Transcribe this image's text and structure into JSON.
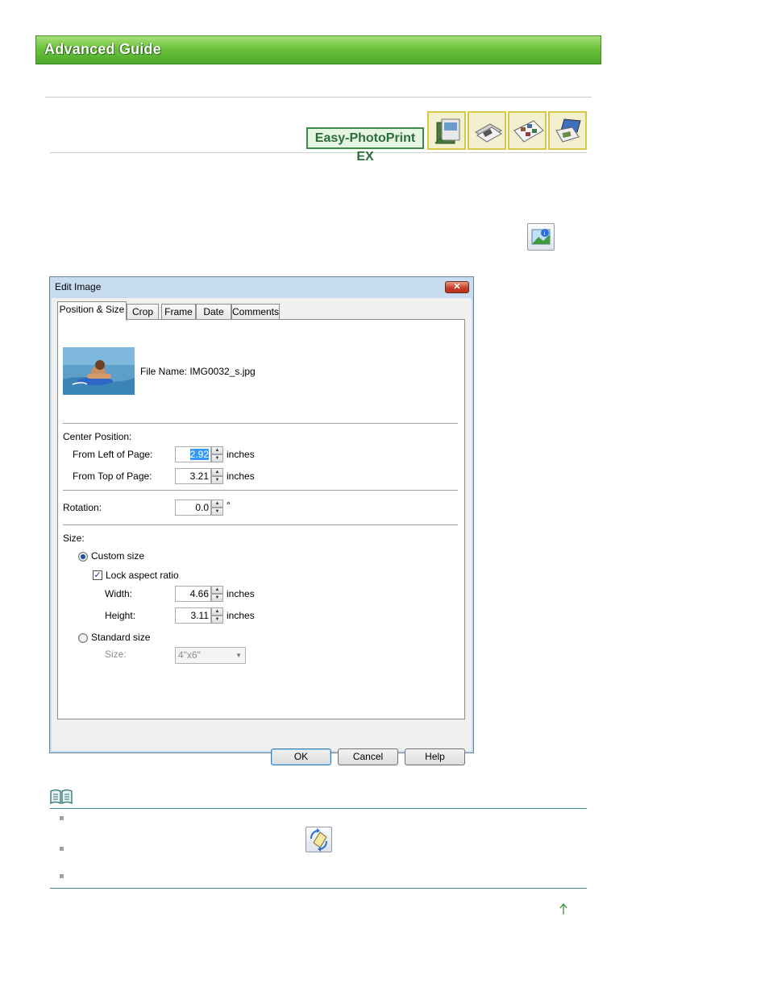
{
  "header": {
    "title": "Advanced Guide"
  },
  "product": {
    "label": "Easy-PhotoPrint EX"
  },
  "icons": {
    "album": "album-icon",
    "layout": "layout-print-icon",
    "sticker": "sticker-icon",
    "calendar": "calendar-icon",
    "properties": "image-properties-icon",
    "rotate": "rotate-icon",
    "note": "note-book-icon",
    "top": "up-arrow-icon"
  },
  "dialog": {
    "title": "Edit Image",
    "close_label": "✕",
    "tabs": [
      {
        "label": "Position & Size",
        "active": true
      },
      {
        "label": "Crop",
        "active": false
      },
      {
        "label": "Frame",
        "active": false
      },
      {
        "label": "Date",
        "active": false
      },
      {
        "label": "Comments",
        "active": false
      }
    ],
    "file_name": "File Name: IMG0032_s.jpg",
    "center_position": {
      "heading": "Center Position:",
      "from_left_label": "From Left of Page:",
      "from_left_value": "2.92",
      "from_top_label": "From Top of Page:",
      "from_top_value": "3.21",
      "unit": "inches"
    },
    "rotation": {
      "label": "Rotation:",
      "value": "0.0",
      "unit": "°"
    },
    "size": {
      "heading": "Size:",
      "custom_label": "Custom size",
      "custom_selected": true,
      "lock_label": "Lock aspect ratio",
      "lock_checked": true,
      "width_label": "Width:",
      "width_value": "4.66",
      "height_label": "Height:",
      "height_value": "3.11",
      "unit": "inches",
      "standard_label": "Standard size",
      "standard_selected": false,
      "size_label": "Size:",
      "size_value": "4\"x6\""
    },
    "buttons": {
      "ok": "OK",
      "cancel": "Cancel",
      "help": "Help"
    }
  },
  "colors": {
    "banner": "#6cc23c",
    "accent": "#3d8a4a",
    "rule": "#3d8a8a"
  }
}
